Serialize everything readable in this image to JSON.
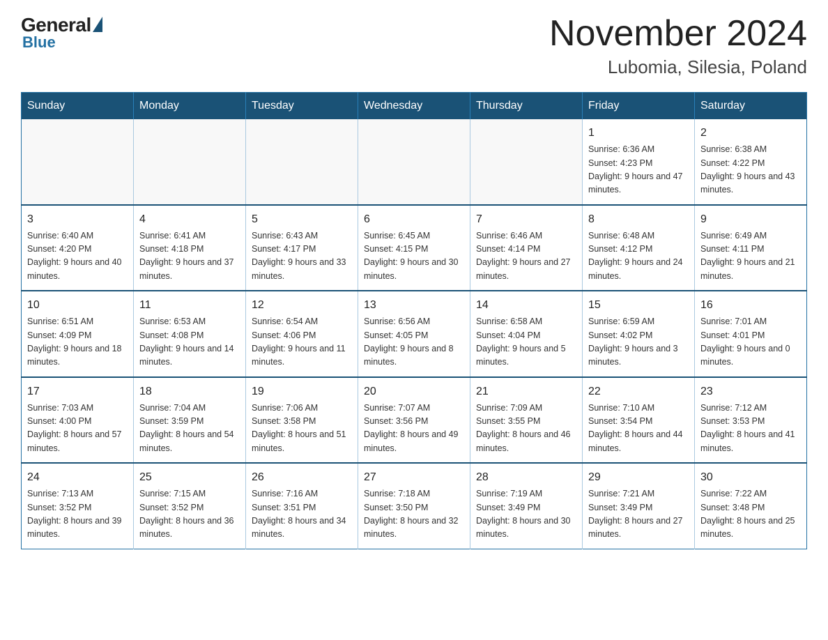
{
  "logo": {
    "general": "General",
    "blue": "Blue"
  },
  "title": {
    "month": "November 2024",
    "location": "Lubomia, Silesia, Poland"
  },
  "days_header": [
    "Sunday",
    "Monday",
    "Tuesday",
    "Wednesday",
    "Thursday",
    "Friday",
    "Saturday"
  ],
  "weeks": [
    [
      {
        "day": "",
        "info": ""
      },
      {
        "day": "",
        "info": ""
      },
      {
        "day": "",
        "info": ""
      },
      {
        "day": "",
        "info": ""
      },
      {
        "day": "",
        "info": ""
      },
      {
        "day": "1",
        "info": "Sunrise: 6:36 AM\nSunset: 4:23 PM\nDaylight: 9 hours and 47 minutes."
      },
      {
        "day": "2",
        "info": "Sunrise: 6:38 AM\nSunset: 4:22 PM\nDaylight: 9 hours and 43 minutes."
      }
    ],
    [
      {
        "day": "3",
        "info": "Sunrise: 6:40 AM\nSunset: 4:20 PM\nDaylight: 9 hours and 40 minutes."
      },
      {
        "day": "4",
        "info": "Sunrise: 6:41 AM\nSunset: 4:18 PM\nDaylight: 9 hours and 37 minutes."
      },
      {
        "day": "5",
        "info": "Sunrise: 6:43 AM\nSunset: 4:17 PM\nDaylight: 9 hours and 33 minutes."
      },
      {
        "day": "6",
        "info": "Sunrise: 6:45 AM\nSunset: 4:15 PM\nDaylight: 9 hours and 30 minutes."
      },
      {
        "day": "7",
        "info": "Sunrise: 6:46 AM\nSunset: 4:14 PM\nDaylight: 9 hours and 27 minutes."
      },
      {
        "day": "8",
        "info": "Sunrise: 6:48 AM\nSunset: 4:12 PM\nDaylight: 9 hours and 24 minutes."
      },
      {
        "day": "9",
        "info": "Sunrise: 6:49 AM\nSunset: 4:11 PM\nDaylight: 9 hours and 21 minutes."
      }
    ],
    [
      {
        "day": "10",
        "info": "Sunrise: 6:51 AM\nSunset: 4:09 PM\nDaylight: 9 hours and 18 minutes."
      },
      {
        "day": "11",
        "info": "Sunrise: 6:53 AM\nSunset: 4:08 PM\nDaylight: 9 hours and 14 minutes."
      },
      {
        "day": "12",
        "info": "Sunrise: 6:54 AM\nSunset: 4:06 PM\nDaylight: 9 hours and 11 minutes."
      },
      {
        "day": "13",
        "info": "Sunrise: 6:56 AM\nSunset: 4:05 PM\nDaylight: 9 hours and 8 minutes."
      },
      {
        "day": "14",
        "info": "Sunrise: 6:58 AM\nSunset: 4:04 PM\nDaylight: 9 hours and 5 minutes."
      },
      {
        "day": "15",
        "info": "Sunrise: 6:59 AM\nSunset: 4:02 PM\nDaylight: 9 hours and 3 minutes."
      },
      {
        "day": "16",
        "info": "Sunrise: 7:01 AM\nSunset: 4:01 PM\nDaylight: 9 hours and 0 minutes."
      }
    ],
    [
      {
        "day": "17",
        "info": "Sunrise: 7:03 AM\nSunset: 4:00 PM\nDaylight: 8 hours and 57 minutes."
      },
      {
        "day": "18",
        "info": "Sunrise: 7:04 AM\nSunset: 3:59 PM\nDaylight: 8 hours and 54 minutes."
      },
      {
        "day": "19",
        "info": "Sunrise: 7:06 AM\nSunset: 3:58 PM\nDaylight: 8 hours and 51 minutes."
      },
      {
        "day": "20",
        "info": "Sunrise: 7:07 AM\nSunset: 3:56 PM\nDaylight: 8 hours and 49 minutes."
      },
      {
        "day": "21",
        "info": "Sunrise: 7:09 AM\nSunset: 3:55 PM\nDaylight: 8 hours and 46 minutes."
      },
      {
        "day": "22",
        "info": "Sunrise: 7:10 AM\nSunset: 3:54 PM\nDaylight: 8 hours and 44 minutes."
      },
      {
        "day": "23",
        "info": "Sunrise: 7:12 AM\nSunset: 3:53 PM\nDaylight: 8 hours and 41 minutes."
      }
    ],
    [
      {
        "day": "24",
        "info": "Sunrise: 7:13 AM\nSunset: 3:52 PM\nDaylight: 8 hours and 39 minutes."
      },
      {
        "day": "25",
        "info": "Sunrise: 7:15 AM\nSunset: 3:52 PM\nDaylight: 8 hours and 36 minutes."
      },
      {
        "day": "26",
        "info": "Sunrise: 7:16 AM\nSunset: 3:51 PM\nDaylight: 8 hours and 34 minutes."
      },
      {
        "day": "27",
        "info": "Sunrise: 7:18 AM\nSunset: 3:50 PM\nDaylight: 8 hours and 32 minutes."
      },
      {
        "day": "28",
        "info": "Sunrise: 7:19 AM\nSunset: 3:49 PM\nDaylight: 8 hours and 30 minutes."
      },
      {
        "day": "29",
        "info": "Sunrise: 7:21 AM\nSunset: 3:49 PM\nDaylight: 8 hours and 27 minutes."
      },
      {
        "day": "30",
        "info": "Sunrise: 7:22 AM\nSunset: 3:48 PM\nDaylight: 8 hours and 25 minutes."
      }
    ]
  ]
}
